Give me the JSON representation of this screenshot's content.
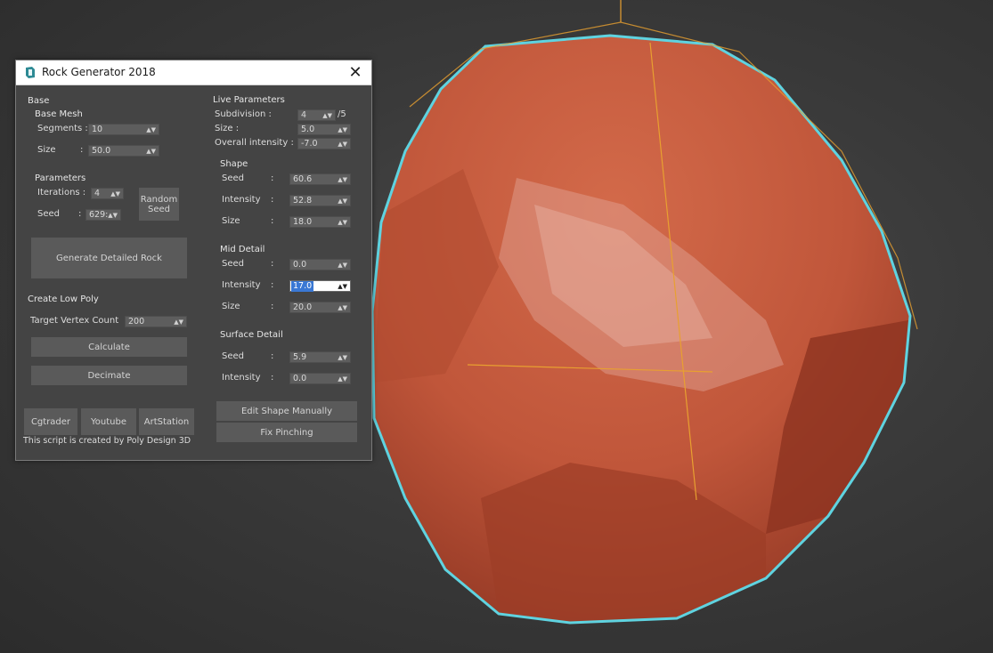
{
  "window": {
    "title": "Rock Generator 2018",
    "close_glyph": "✕"
  },
  "base": {
    "heading": "Base",
    "base_mesh_heading": "Base Mesh",
    "segments_label": "Segments :",
    "segments_value": "10",
    "size_label": "Size",
    "size_colon": ":",
    "size_value": "50.0",
    "parameters_heading": "Parameters",
    "iterations_label": "Iterations :",
    "iterations_value": "4",
    "seed_label": "Seed",
    "seed_colon": ":",
    "seed_value": "629:",
    "random_seed_label": "Random Seed",
    "generate_label": "Generate Detailed Rock"
  },
  "low_poly": {
    "heading": "Create Low Poly",
    "target_label": "Target Vertex Count",
    "target_value": "200",
    "calculate_label": "Calculate",
    "decimate_label": "Decimate"
  },
  "links": {
    "cgtrader": "Cgtrader",
    "youtube": "Youtube",
    "artstation": "ArtStation",
    "credit": "This script is created by Poly Design 3D"
  },
  "live": {
    "heading": "Live Parameters",
    "subdivision_label": "Subdivision :",
    "subdivision_value": "4",
    "subdivision_max": "/5",
    "size_label": "Size :",
    "size_value": "5.0",
    "overall_label": "Overall intensity :",
    "overall_value": "-7.0",
    "colon": ":",
    "shape": {
      "heading": "Shape",
      "seed_label": "Seed",
      "seed_value": "60.6",
      "intensity_label": "Intensity",
      "intensity_value": "52.8",
      "size_label": "Size",
      "size_value": "18.0"
    },
    "mid": {
      "heading": "Mid Detail",
      "seed_label": "Seed",
      "seed_value": "0.0",
      "intensity_label": "Intensity",
      "intensity_value": "17.0",
      "size_label": "Size",
      "size_value": "20.0"
    },
    "surface": {
      "heading": "Surface Detail",
      "seed_label": "Seed",
      "seed_value": "5.9",
      "intensity_label": "Intensity",
      "intensity_value": "0.0"
    },
    "edit_shape_label": "Edit Shape Manually",
    "fix_pinching_label": "Fix Pinching"
  },
  "colors": {
    "dialog_bg": "#444444",
    "rock": "#c4583a",
    "selection_outline": "#5fd3e0",
    "gizmo": "#e8a030",
    "active_field": "#3a78d4"
  },
  "icons": {
    "app": "max-app-icon",
    "close": "close-icon",
    "spinner": "spinner-arrows-icon"
  }
}
